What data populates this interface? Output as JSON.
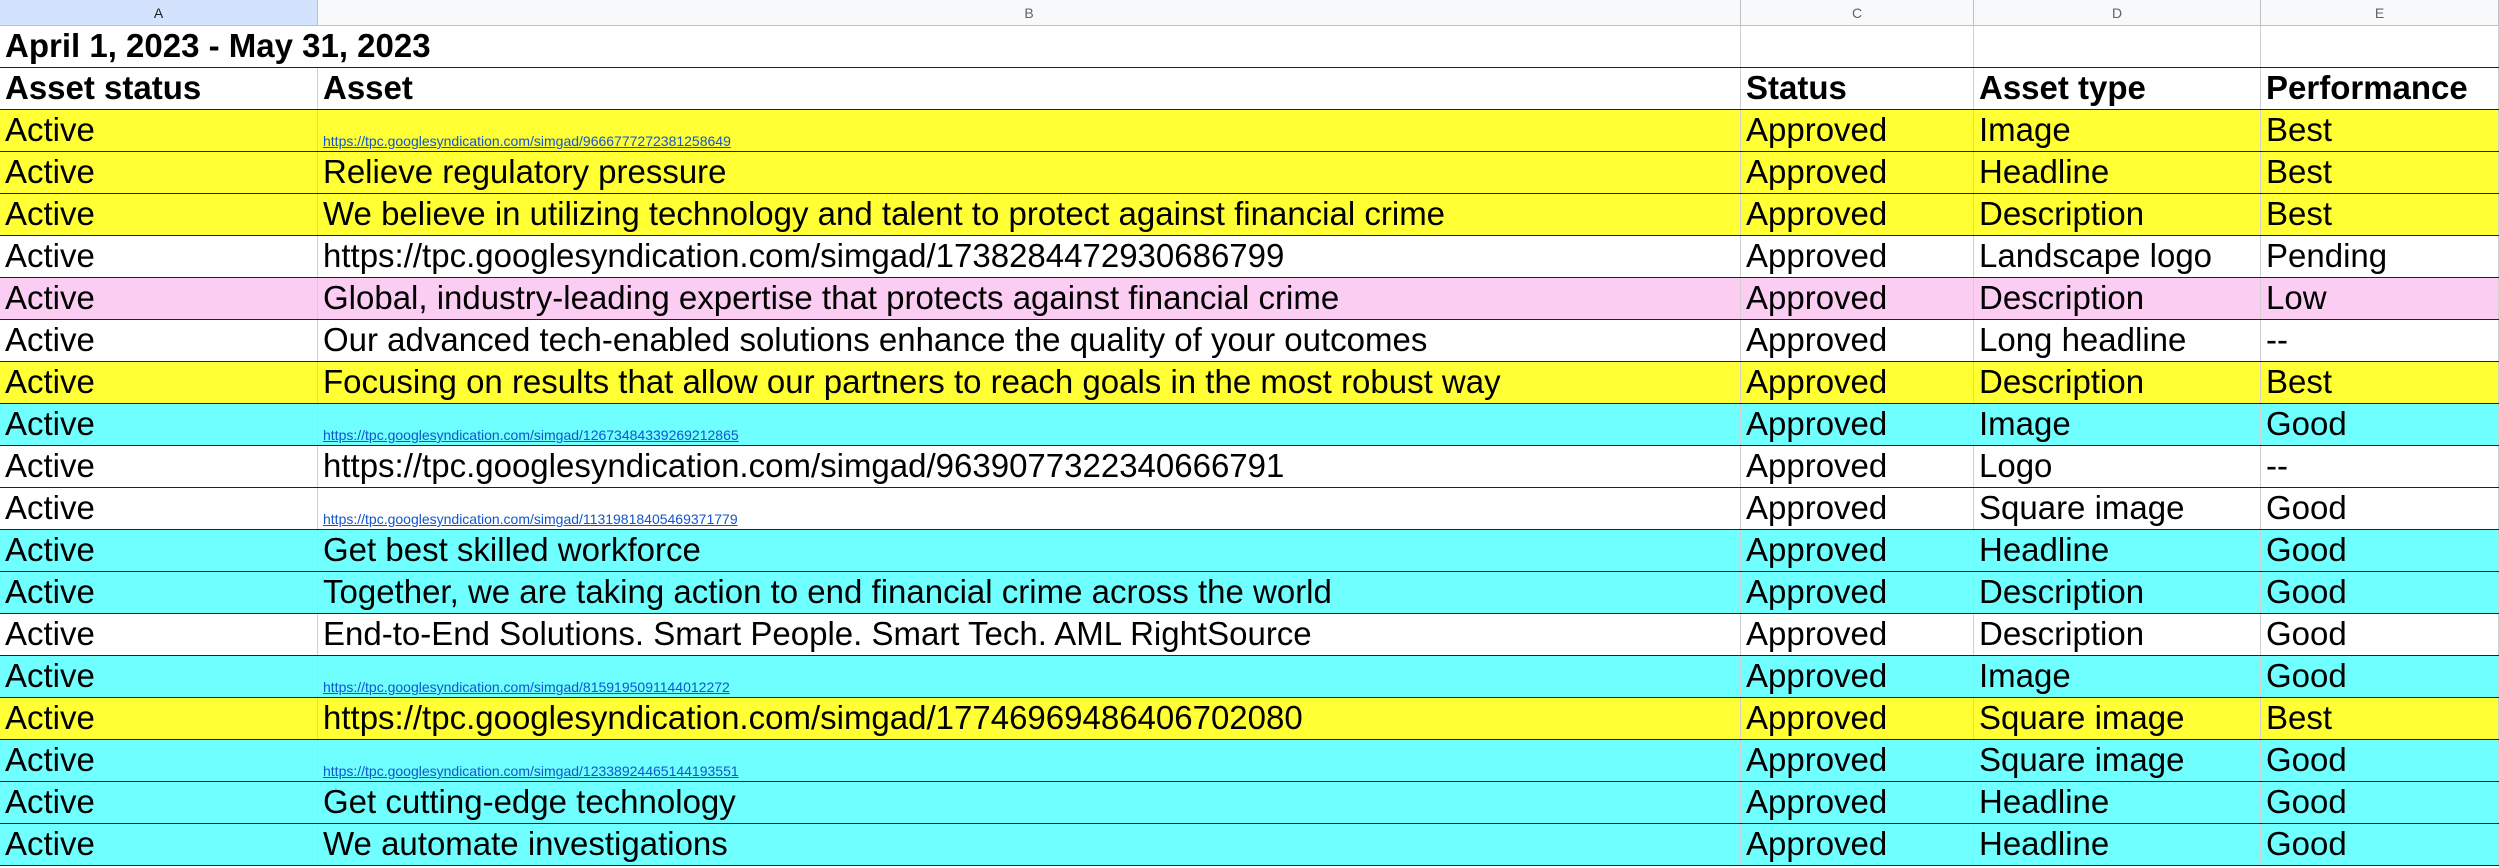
{
  "columns": [
    "A",
    "B",
    "C",
    "D",
    "E"
  ],
  "date_range": "April 1, 2023 - May 31, 2023",
  "headers": [
    "Asset status",
    "Asset",
    "Status",
    "Asset type",
    "Performance"
  ],
  "colors": {
    "yellow": "#ffff33",
    "cyan": "#70ffff",
    "pink": "#fbcdf3",
    "white": "#ffffff"
  },
  "rows": [
    {
      "status": "Active",
      "asset": "https://tpc.googlesyndication.com/simgad/9666777272381258649",
      "asset_is_link": true,
      "approval": "Approved",
      "type": "Image",
      "performance": "Best",
      "color": "yellow"
    },
    {
      "status": "Active",
      "asset": "Relieve regulatory pressure",
      "asset_is_link": false,
      "approval": "Approved",
      "type": "Headline",
      "performance": "Best",
      "color": "yellow"
    },
    {
      "status": "Active",
      "asset": "We believe in utilizing technology and talent to protect against financial crime",
      "asset_is_link": false,
      "approval": "Approved",
      "type": "Description",
      "performance": "Best",
      "color": "yellow"
    },
    {
      "status": "Active",
      "asset": "https://tpc.googlesyndication.com/simgad/17382844729306867​99",
      "asset_is_link": false,
      "approval": "Approved",
      "type": "Landscape logo",
      "performance": "Pending",
      "color": "white"
    },
    {
      "status": "Active",
      "asset": "Global, industry-leading expertise that protects against financial crime",
      "asset_is_link": false,
      "approval": "Approved",
      "type": "Description",
      "performance": "Low",
      "color": "pink"
    },
    {
      "status": "Active",
      "asset": "Our advanced tech-enabled solutions enhance the quality of your outcomes",
      "asset_is_link": false,
      "approval": "Approved",
      "type": "Long headline",
      "performance": " --",
      "color": "white"
    },
    {
      "status": "Active",
      "asset": "Focusing on results that allow our partners to reach goals in the most robust way",
      "asset_is_link": false,
      "approval": "Approved",
      "type": "Description",
      "performance": "Best",
      "color": "yellow"
    },
    {
      "status": "Active",
      "asset": "https://tpc.googlesyndication.com/simgad/12673484339269212865",
      "asset_is_link": true,
      "approval": "Approved",
      "type": "Image",
      "performance": "Good",
      "color": "cyan"
    },
    {
      "status": "Active",
      "asset": "https://tpc.googlesyndication.com/simgad/9639077322340666791",
      "asset_is_link": false,
      "approval": "Approved",
      "type": "Logo",
      "performance": " --",
      "color": "white"
    },
    {
      "status": "Active",
      "asset": "https://tpc.googlesyndication.com/simgad/11319818405469371779",
      "asset_is_link": true,
      "approval": "Approved",
      "type": "Square image",
      "performance": "Good",
      "color": "white"
    },
    {
      "status": "Active",
      "asset": "Get best skilled workforce",
      "asset_is_link": false,
      "approval": "Approved",
      "type": "Headline",
      "performance": "Good",
      "color": "cyan"
    },
    {
      "status": "Active",
      "asset": "Together, we are taking action to end financial crime across the world",
      "asset_is_link": false,
      "approval": "Approved",
      "type": "Description",
      "performance": "Good",
      "color": "cyan"
    },
    {
      "status": "Active",
      "asset": "End-to-End Solutions. Smart People. Smart Tech. AML RightSource",
      "asset_is_link": false,
      "approval": "Approved",
      "type": "Description",
      "performance": "Good",
      "color": "white"
    },
    {
      "status": "Active",
      "asset": "https://tpc.googlesyndication.com/simgad/8159195091144012272",
      "asset_is_link": true,
      "approval": "Approved",
      "type": "Image",
      "performance": "Good",
      "color": "cyan"
    },
    {
      "status": "Active",
      "asset": "https://tpc.googlesyndication.com/simgad/17746969486406702080",
      "asset_is_link": false,
      "approval": "Approved",
      "type": "Square image",
      "performance": "Best",
      "color": "yellow"
    },
    {
      "status": "Active",
      "asset": "https://tpc.googlesyndication.com/simgad/12338924465144193551",
      "asset_is_link": true,
      "approval": "Approved",
      "type": "Square image",
      "performance": "Good",
      "color": "cyan"
    },
    {
      "status": "Active",
      "asset": "Get cutting-edge technology",
      "asset_is_link": false,
      "approval": "Approved",
      "type": "Headline",
      "performance": "Good",
      "color": "cyan"
    },
    {
      "status": "Active",
      "asset": "We automate investigations",
      "asset_is_link": false,
      "approval": "Approved",
      "type": "Headline",
      "performance": "Good",
      "color": "cyan"
    }
  ]
}
